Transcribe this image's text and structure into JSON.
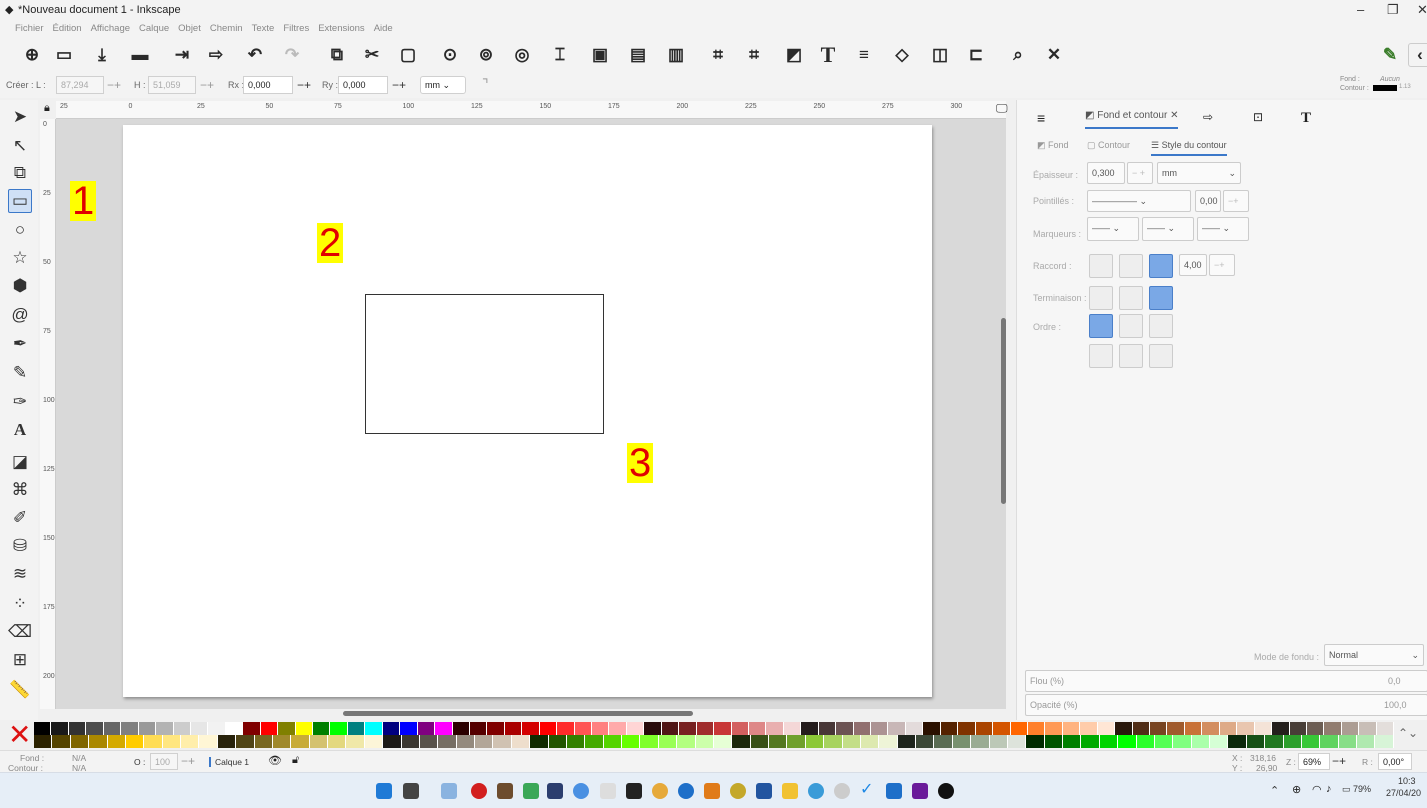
{
  "window": {
    "title": "*Nouveau document 1 - Inkscape",
    "minimize": "–",
    "maximize": "❐",
    "close": "✕"
  },
  "menu": [
    "Fichier",
    "Édition",
    "Affichage",
    "Calque",
    "Objet",
    "Chemin",
    "Texte",
    "Filtres",
    "Extensions",
    "Aide"
  ],
  "toolbar_icons": [
    "new-document-icon",
    "open-icon",
    "save-icon",
    "print-icon",
    "import-icon",
    "export-icon",
    "undo-icon",
    "redo-icon",
    "duplicate-icon",
    "cut-icon",
    "paste-icon",
    "zoom-selection-icon",
    "zoom-drawing-icon",
    "zoom-page-icon",
    "zoom-width-icon",
    "group-icon",
    "ungroup-icon",
    "clip-icon",
    "select-all-icon",
    "select-all-layers-icon",
    "fill-stroke-icon",
    "text-font-icon",
    "align-icon",
    "xml-editor-icon",
    "layers-icon",
    "distribute-icon",
    "find-icon",
    "preferences-icon"
  ],
  "controls": {
    "create_label": "Créer : L :",
    "width": "87,294",
    "h_label": "H :",
    "height": "51,059",
    "rx_label": "Rx :",
    "rx": "0,000",
    "ry_label": "Ry :",
    "ry": "0,000",
    "unit": "mm",
    "fill_label": "Fond :",
    "fill_value": "Aucun",
    "stroke_label": "Contour :",
    "stroke_width": "1.13"
  },
  "ruler": {
    "h_ticks": [
      "25",
      "0",
      "25",
      "50",
      "75",
      "100",
      "125",
      "150",
      "175",
      "200",
      "225",
      "250",
      "275",
      "300"
    ],
    "v_ticks": [
      "0",
      "25",
      "50",
      "75",
      "100",
      "125",
      "150",
      "175",
      "200"
    ]
  },
  "annotations": [
    "1",
    "2",
    "3"
  ],
  "panel": {
    "tab_active": "Fond et contour",
    "tab_close": "✕",
    "subtabs": [
      "Fond",
      "Contour",
      "Style du contour"
    ],
    "epaisseur_label": "Épaisseur :",
    "epaisseur": "0,300",
    "epaisseur_unit": "mm",
    "pointilles_label": "Pointillés :",
    "pointilles_value": "0,00",
    "marqueurs_label": "Marqueurs :",
    "raccord_label": "Raccord :",
    "raccord_value": "4,00",
    "terminaison_label": "Terminaison :",
    "ordre_label": "Ordre :",
    "blend_label": "Mode de fondu :",
    "blend_value": "Normal",
    "flou_label": "Flou (%)",
    "flou_value": "0,0",
    "opacite_label": "Opacité (%)",
    "opacite_value": "100,0"
  },
  "status": {
    "fond_label": "Fond :",
    "fond_value": "N/A",
    "contour_label": "Contour :",
    "contour_value": "N/A",
    "o_label": "O :",
    "opacity": "100",
    "layer": "Calque 1",
    "x_label": "X :",
    "x_value": "318,16",
    "y_label": "Y :",
    "y_value": "26,90",
    "z_label": "Z :",
    "zoom": "69%",
    "r_label": "R :",
    "rotation": "0,00°"
  },
  "taskbar": {
    "battery": "79%",
    "time": "10:3",
    "date": "27/04/20"
  },
  "palette_colors": [
    "#000000",
    "#1a1a1a",
    "#333333",
    "#4d4d4d",
    "#666666",
    "#808080",
    "#999999",
    "#b3b3b3",
    "#cccccc",
    "#e6e6e6",
    "#f2f2f2",
    "#ffffff",
    "#800000",
    "#ff0000",
    "#808000",
    "#ffff00",
    "#008000",
    "#00ff00",
    "#008080",
    "#00ffff",
    "#000080",
    "#0000ff",
    "#800080",
    "#ff00ff",
    "#2b0000",
    "#550000",
    "#800000",
    "#aa0000",
    "#d40000",
    "#ff0000",
    "#ff2a2a",
    "#ff5555",
    "#ff8080",
    "#ffaaaa",
    "#ffd5d5",
    "#280b0b",
    "#501616",
    "#782121",
    "#a02c2c",
    "#c83737",
    "#d35f5f",
    "#de8787",
    "#e9afaf",
    "#f4d7d7",
    "#241c1c",
    "#483737",
    "#6c5353",
    "#916f6f",
    "#ac9393",
    "#c8b7b7",
    "#e3dbdb",
    "#2b1100",
    "#552200",
    "#803300",
    "#aa4400",
    "#d45500",
    "#ff6600",
    "#ff7f2a",
    "#ff9955",
    "#ffb380",
    "#ffccaa",
    "#ffe6d5",
    "#28170b",
    "#502d16",
    "#784421",
    "#a05a2c",
    "#c87137",
    "#d38d5f",
    "#deaa87",
    "#e9c6af",
    "#f4e3d7",
    "#241f1c",
    "#483e37",
    "#6c5d53",
    "#917c6f",
    "#ac9d93",
    "#c8beb7",
    "#e3dedb"
  ],
  "palette_colors2": [
    "#2b2200",
    "#554400",
    "#806600",
    "#aa8800",
    "#d4aa00",
    "#ffcc00",
    "#ffdd55",
    "#ffe680",
    "#ffeeaa",
    "#fff6d5",
    "#28220b",
    "#504416",
    "#786721",
    "#a0892c",
    "#c8ab37",
    "#d4c26f",
    "#e3d87f",
    "#f0e8a8",
    "#fcf5d8",
    "#1c1a17",
    "#3a3630",
    "#58524a",
    "#766e64",
    "#948a7e",
    "#b2a698",
    "#d0c2b2",
    "#eedecc",
    "#112b00",
    "#225500",
    "#338000",
    "#44aa00",
    "#55d400",
    "#66ff00",
    "#7fff2a",
    "#99ff55",
    "#b3ff80",
    "#ccffaa",
    "#e6ffd5",
    "#1c280b",
    "#385016",
    "#547821",
    "#70a02c",
    "#8cc837",
    "#a7d35f",
    "#c3de87",
    "#dde9af",
    "#eef4d7",
    "#1e241c",
    "#3c4837",
    "#5a6c53",
    "#78916f",
    "#9aac93",
    "#bcc8b7",
    "#dde3db",
    "#002b00",
    "#005500",
    "#008000",
    "#00aa00",
    "#00d400",
    "#00ff00",
    "#2aff2a",
    "#55ff55",
    "#80ff80",
    "#aaffaa",
    "#d5ffd5",
    "#0b280b",
    "#165016",
    "#217821",
    "#2ca02c",
    "#37c837",
    "#5fd35f",
    "#87de87",
    "#afe9af",
    "#d7f4d7"
  ]
}
